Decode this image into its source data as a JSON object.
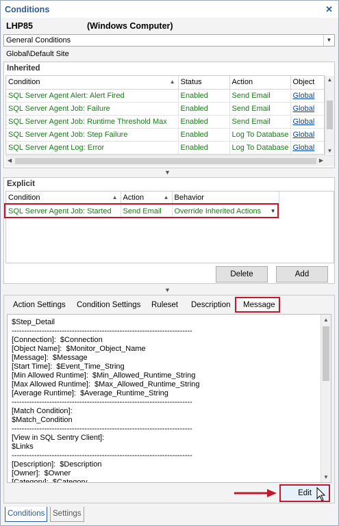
{
  "window": {
    "title": "Conditions",
    "close_glyph": "✕"
  },
  "target": {
    "name": "LHP85",
    "type": "(Windows Computer)"
  },
  "condition_type": {
    "selected": "General Conditions"
  },
  "path": "Global\\Default Site",
  "inherited": {
    "title": "Inherited",
    "columns": [
      "Condition",
      "Status",
      "Action",
      "Object"
    ],
    "rows": [
      [
        "SQL Server Agent Alert: Alert Fired",
        "Enabled",
        "Send Email",
        "Global"
      ],
      [
        "SQL Server Agent Job: Failure",
        "Enabled",
        "Send Email",
        "Global"
      ],
      [
        "SQL Server Agent Job: Runtime Threshold Max",
        "Enabled",
        "Send Email",
        "Global"
      ],
      [
        "SQL Server Agent Job: Step Failure",
        "Enabled",
        "Log To Database",
        "Global"
      ],
      [
        "SQL Server Agent Log: Error",
        "Enabled",
        "Log To Database",
        "Global"
      ]
    ]
  },
  "explicit": {
    "title": "Explicit",
    "columns": [
      "Condition",
      "Action",
      "Behavior"
    ],
    "rows": [
      [
        "SQL Server Agent Job: Started",
        "Send Email",
        "Override Inherited Actions"
      ]
    ],
    "delete_label": "Delete",
    "add_label": "Add"
  },
  "tabs": [
    "Action Settings",
    "Condition Settings",
    "Ruleset",
    "Description",
    "Message"
  ],
  "active_tab": "Message",
  "message_text": "$Step_Detail\n------------------------------------------------------------------------\n[Connection]:  $Connection\n[Object Name]:  $Monitor_Object_Name\n[Message]:  $Message\n[Start Time]:  $Event_Time_String\n[Min Allowed Runtime]:  $Min_Allowed_Runtime_String\n[Max Allowed Runtime]:  $Max_Allowed_Runtime_String\n[Average Runtime]:  $Average_Runtime_String\n------------------------------------------------------------------------\n[Match Condition]:\n$Match_Condition\n------------------------------------------------------------------------\n[View in SQL Sentry Client]:\n$Links\n------------------------------------------------------------------------\n[Description]:  $Description\n[Owner]:  $Owner\n[Category]:  $Category",
  "edit_label": "Edit",
  "bottom_tabs": [
    "Conditions",
    "Settings"
  ],
  "colors": {
    "accent": "#2a5b9a",
    "enabled_text": "#1a7a1a",
    "highlight": "#c0182c",
    "link": "#0645ad"
  }
}
